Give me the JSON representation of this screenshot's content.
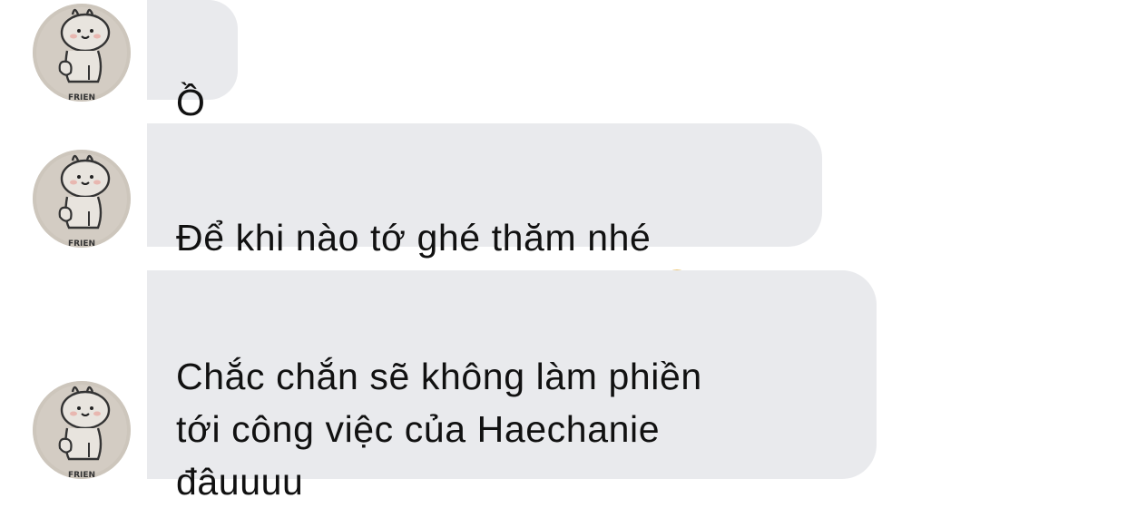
{
  "messages": [
    {
      "text": "Ồ",
      "emoji": ""
    },
    {
      "text": "Để khi nào tớ ghé thăm nhé",
      "emoji": "face-with-hand-over-mouth-icon"
    },
    {
      "text": "Chắc chắn sẽ không làm phiền\ntới công việc của Haechanie\nđâuuuu",
      "emoji": ""
    }
  ],
  "avatar": {
    "icon": "bunny-sticker-avatar-icon",
    "caption": "FRIEN"
  },
  "colors": {
    "bubble": "#e9eaed",
    "text": "#111111",
    "avatar_bg": "#cfc8bf"
  }
}
